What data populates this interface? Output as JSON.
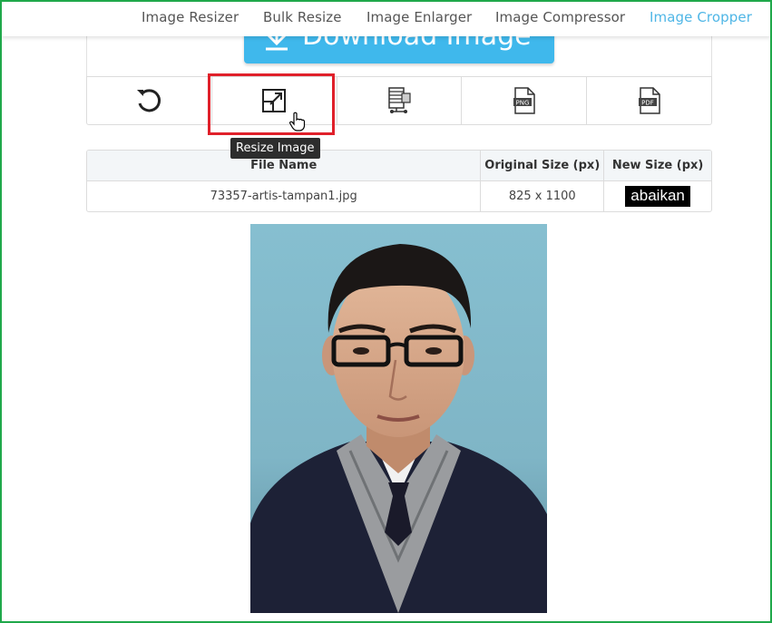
{
  "nav": {
    "items": [
      "Image Resizer",
      "Bulk Resize",
      "Image Enlarger",
      "Image Compressor",
      "Image Cropper"
    ],
    "active_index": 4,
    "active_color": "#4fb6e6"
  },
  "download": {
    "label": "Download Image",
    "color": "#3fb8ec"
  },
  "toolbar": {
    "tools": [
      "undo-icon",
      "resize-icon",
      "compress-icon",
      "png-icon",
      "pdf-icon"
    ],
    "png_text": "PNG",
    "pdf_text": "PDF",
    "tooltip": "Resize Image",
    "highlight_color": "#e0202a"
  },
  "table": {
    "headers": [
      "File Name",
      "Original Size (px)",
      "New Size (px)"
    ],
    "row": {
      "file_name": "73357-artis-tampan1.jpg",
      "original_size": "825 x 1100",
      "new_size": "abaikan"
    }
  },
  "frame_color": "#1fa84a"
}
